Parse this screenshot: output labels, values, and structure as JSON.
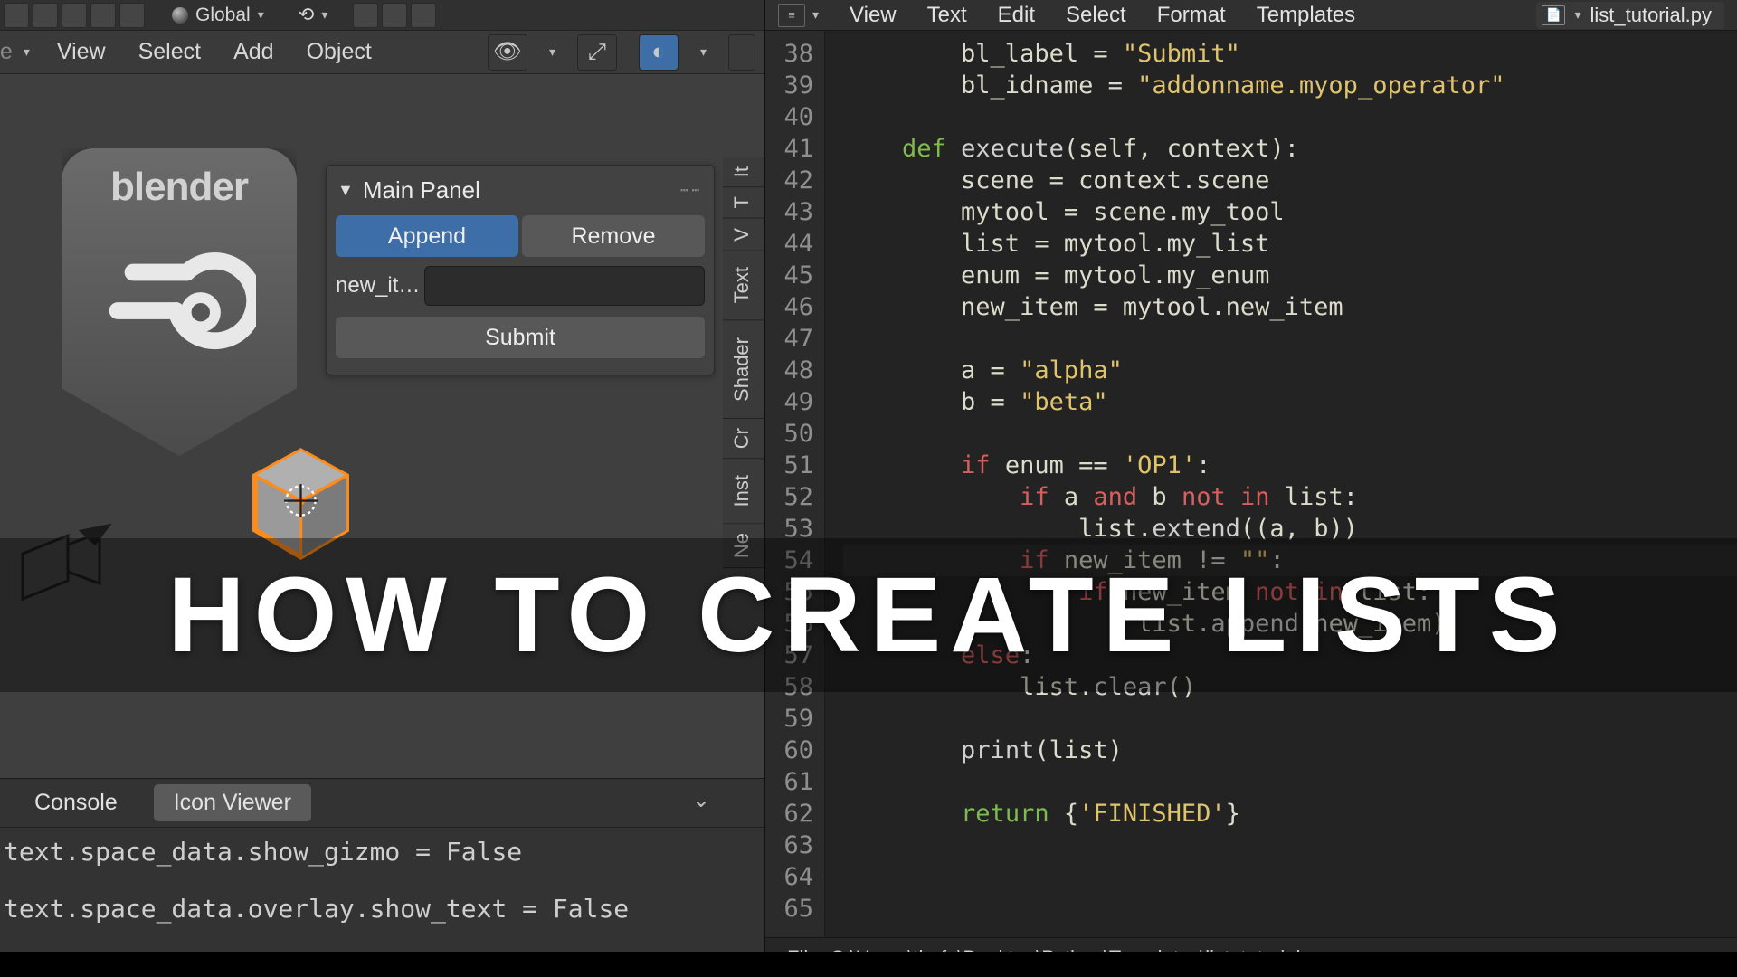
{
  "left": {
    "orientation_mode": "Global",
    "mode_label": "de",
    "menus": [
      "View",
      "Select",
      "Add",
      "Object"
    ],
    "panel": {
      "title": "Main Panel",
      "append": "Append",
      "remove": "Remove",
      "field_label": "new_it…",
      "field_value": "",
      "submit": "Submit"
    },
    "side_tabs": [
      "It",
      "T",
      "V",
      "Text",
      "Shader",
      "Cr",
      "Inst",
      "Ne"
    ],
    "blender_word": "blender",
    "console_tab1": "Console",
    "console_tab2": "Icon Viewer",
    "console_lines": [
      "text.space_data.show_gizmo = False",
      "text.space_data.overlay.show_text = False"
    ]
  },
  "right": {
    "menus": [
      "View",
      "Text",
      "Edit",
      "Select",
      "Format",
      "Templates"
    ],
    "filename": "list_tutorial.py",
    "footer": "File: C:\\Users\\thefa\\Desktop\\Python\\Templates\\list_tutorial.py",
    "first_line_no": 38,
    "code": [
      {
        "n": 38,
        "i": 2,
        "raw": "bl_label = \"Submit\""
      },
      {
        "n": 39,
        "i": 2,
        "raw": "bl_idname = \"addonname.myop_operator\""
      },
      {
        "n": 40,
        "i": 0,
        "raw": ""
      },
      {
        "n": 41,
        "i": 1,
        "raw": "def execute(self, context):"
      },
      {
        "n": 42,
        "i": 2,
        "raw": "scene = context.scene"
      },
      {
        "n": 43,
        "i": 2,
        "raw": "mytool = scene.my_tool"
      },
      {
        "n": 44,
        "i": 2,
        "raw": "list = mytool.my_list"
      },
      {
        "n": 45,
        "i": 2,
        "raw": "enum = mytool.my_enum"
      },
      {
        "n": 46,
        "i": 2,
        "raw": "new_item = mytool.new_item"
      },
      {
        "n": 47,
        "i": 0,
        "raw": ""
      },
      {
        "n": 48,
        "i": 2,
        "raw": "a = \"alpha\""
      },
      {
        "n": 49,
        "i": 2,
        "raw": "b = \"beta\""
      },
      {
        "n": 50,
        "i": 0,
        "raw": ""
      },
      {
        "n": 51,
        "i": 2,
        "raw": "if enum == 'OP1':"
      },
      {
        "n": 52,
        "i": 3,
        "raw": "if a and b not in list:"
      },
      {
        "n": 53,
        "i": 4,
        "raw": "list.extend((a, b))"
      },
      {
        "n": 54,
        "i": 3,
        "raw": "if new_item != \"\":",
        "hl": true
      },
      {
        "n": 55,
        "i": 4,
        "raw": "if new_item not in list:"
      },
      {
        "n": 56,
        "i": 5,
        "raw": "list.append(new_item)"
      },
      {
        "n": 57,
        "i": 2,
        "raw": "else:"
      },
      {
        "n": 58,
        "i": 3,
        "raw": "list.clear()"
      },
      {
        "n": 59,
        "i": 0,
        "raw": ""
      },
      {
        "n": 60,
        "i": 2,
        "raw": "print(list)"
      },
      {
        "n": 61,
        "i": 0,
        "raw": ""
      },
      {
        "n": 62,
        "i": 2,
        "raw": "return {'FINISHED'}"
      },
      {
        "n": 63,
        "i": 0,
        "raw": ""
      },
      {
        "n": 64,
        "i": 0,
        "raw": ""
      },
      {
        "n": 65,
        "i": 0,
        "raw": ""
      }
    ]
  },
  "overlay": {
    "title": "HOW TO CREATE LISTS"
  },
  "colors": {
    "accent_blue": "#3d6ea8",
    "cube_orange": "#ff8c1a",
    "axis_green": "#6db82a",
    "axis_red": "#a52e2e"
  }
}
